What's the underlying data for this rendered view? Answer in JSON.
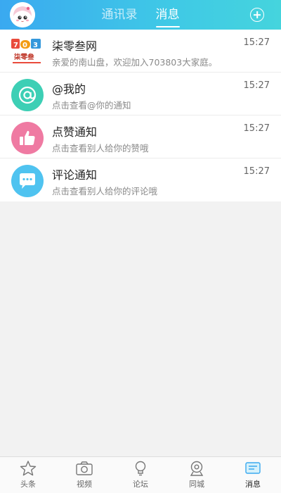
{
  "header": {
    "tabs": [
      {
        "label": "通讯录",
        "active": false
      },
      {
        "label": "消息",
        "active": true
      }
    ]
  },
  "messages": [
    {
      "title": "柒零叁网",
      "subtitle": "亲爱的南山盘，欢迎加入703803大家庭。",
      "time": "15:27",
      "icon": "logo-icon",
      "logo_text": "柒零叁"
    },
    {
      "title": "@我的",
      "subtitle": "点击查看@你的通知",
      "time": "15:27",
      "icon": "at-icon"
    },
    {
      "title": "点赞通知",
      "subtitle": "点击查看别人给你的赞哦",
      "time": "15:27",
      "icon": "thumbs-up-icon"
    },
    {
      "title": "评论通知",
      "subtitle": "点击查看别人给你的评论哦",
      "time": "15:27",
      "icon": "comment-icon"
    }
  ],
  "bottom_nav": [
    {
      "label": "头条",
      "icon": "star-icon",
      "active": false
    },
    {
      "label": "视频",
      "icon": "camera-icon",
      "active": false
    },
    {
      "label": "论坛",
      "icon": "bulb-icon",
      "active": false
    },
    {
      "label": "同城",
      "icon": "location-icon",
      "active": false
    },
    {
      "label": "消息",
      "icon": "message-icon",
      "active": true
    }
  ],
  "colors": {
    "header_start": "#3aa9f0",
    "header_end": "#45d4dd",
    "at_icon_bg": "#3dcfb5",
    "like_icon_bg": "#ef7aa2",
    "comment_icon_bg": "#4fc3f0",
    "nav_active": "#3aa9f0"
  }
}
